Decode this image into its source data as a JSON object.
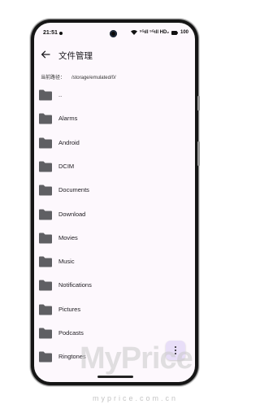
{
  "status_bar": {
    "time": "21:51",
    "signal_text": "⁵ᴳıll ⁵ᴳıll HD₂",
    "battery": "100"
  },
  "app_bar": {
    "title": "文件管理",
    "back_icon": "arrow-back-icon"
  },
  "path": {
    "label": "当前路径：",
    "value": "/storage/emulated/0/"
  },
  "folders": [
    {
      "label": ".."
    },
    {
      "label": "Alarms"
    },
    {
      "label": "Android"
    },
    {
      "label": "DCIM"
    },
    {
      "label": "Documents"
    },
    {
      "label": "Download"
    },
    {
      "label": "Movies"
    },
    {
      "label": "Music"
    },
    {
      "label": "Notifications"
    },
    {
      "label": "Pictures"
    },
    {
      "label": "Podcasts"
    },
    {
      "label": "Ringtones"
    }
  ],
  "fab": {
    "icon": "more-vert-icon"
  },
  "colors": {
    "folder": "#5f5f63",
    "background": "#fdf8fd",
    "fab": "#e8def8"
  },
  "watermark": {
    "brand": "MyPrice",
    "url": "myprice.com.cn"
  }
}
